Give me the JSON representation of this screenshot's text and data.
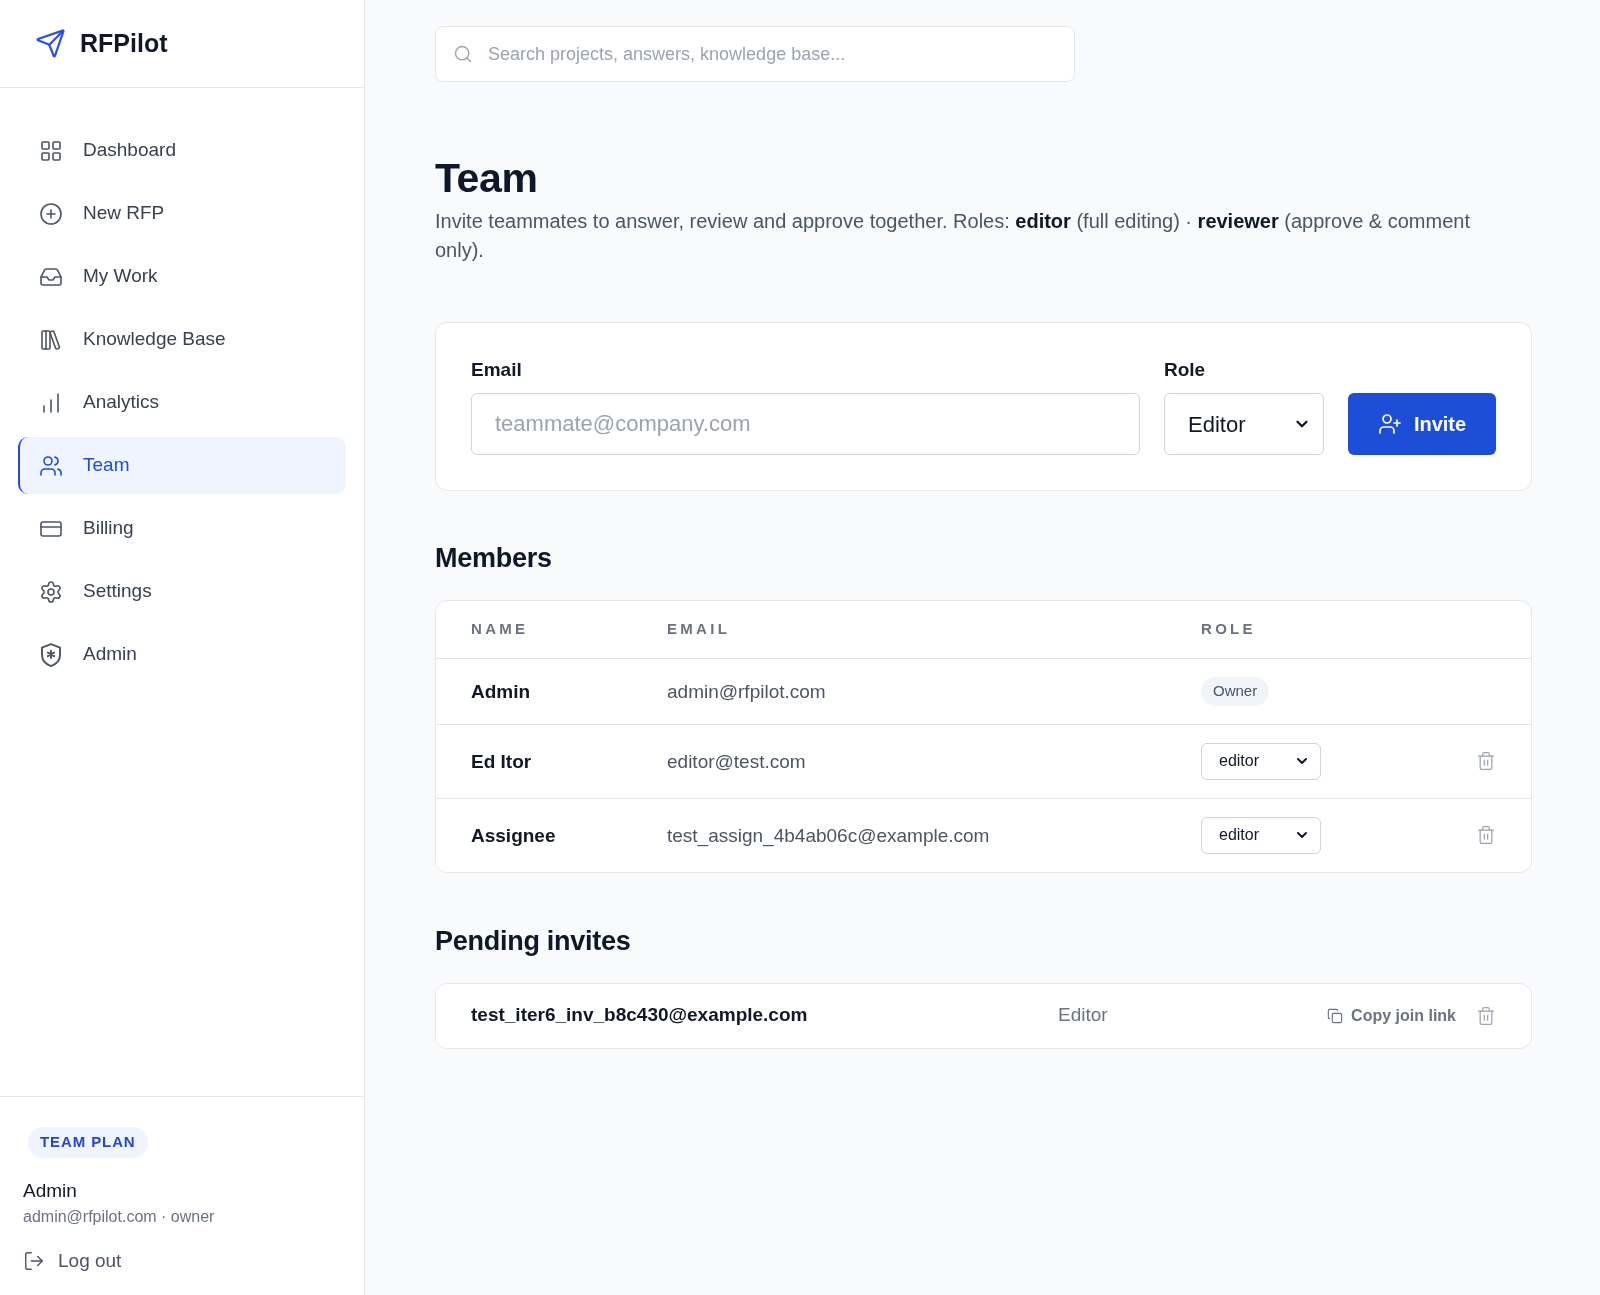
{
  "sidebar": {
    "logo": {
      "text": "RFPilot"
    },
    "items": [
      {
        "label": "Dashboard",
        "selected": false
      },
      {
        "label": "New RFP",
        "selected": false
      },
      {
        "label": "My Work",
        "selected": false
      },
      {
        "label": "Knowledge Base",
        "selected": false
      },
      {
        "label": "Analytics",
        "selected": false
      },
      {
        "label": "Team",
        "selected": true
      },
      {
        "label": "Billing",
        "selected": false
      },
      {
        "label": "Settings",
        "selected": false
      },
      {
        "label": "Admin",
        "selected": false
      }
    ],
    "footer": {
      "plan_badge": "TEAM PLAN",
      "user_name": "Admin",
      "user_detail": "admin@rfpilot.com · owner",
      "logout": "Log out"
    }
  },
  "search": {
    "placeholder": "Search projects, answers, knowledge base..."
  },
  "page": {
    "title": "Team",
    "description": "Invite teammates to answer, review and approve together. Roles: **editor** (full editing) · **reviewer** (approve & comment only)."
  },
  "invite_form": {
    "email_label": "Email",
    "email_placeholder": "teammate@company.com",
    "role_label": "Role",
    "role_value": "Editor",
    "button": "Invite"
  },
  "members": {
    "title": "Members",
    "columns": [
      "NAME",
      "EMAIL",
      "ROLE"
    ],
    "rows": [
      {
        "name": "Admin",
        "email": "admin@rfpilot.com",
        "role": "Owner",
        "kind": "badge"
      },
      {
        "name": "Ed Itor",
        "email": "editor@test.com",
        "role": "editor",
        "kind": "select"
      },
      {
        "name": "Assignee",
        "email": "test_assign_4b4ab06c@example.com",
        "role": "editor",
        "kind": "select"
      }
    ]
  },
  "pending": {
    "title": "Pending invites",
    "items": [
      {
        "email": "test_iter6_inv_b8c430@example.com",
        "role": "Editor",
        "copy_link": "Copy join link"
      }
    ]
  }
}
